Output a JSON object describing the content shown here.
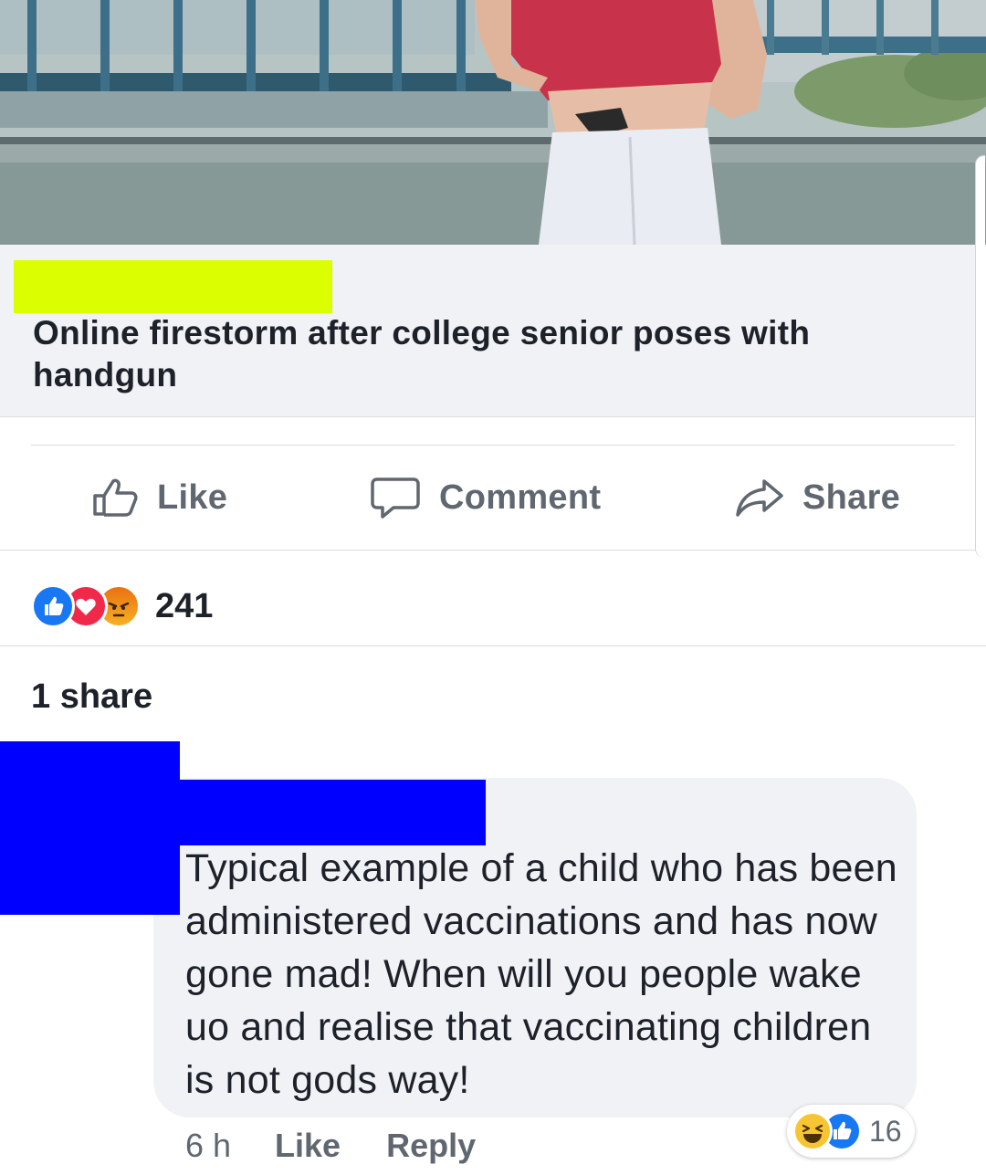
{
  "link_preview": {
    "title": "Online firestorm after college senior poses with handgun"
  },
  "actions": {
    "like_label": "Like",
    "comment_label": "Comment",
    "share_label": "Share"
  },
  "reactions": {
    "types": [
      "like",
      "love",
      "angry"
    ],
    "count": "241"
  },
  "shares": "1 share",
  "comment": {
    "text": "Typical example of a child who has been administered vaccinations and has now gone mad! When will you people wake uo and realise that vaccinating children is not gods way!",
    "time": "6 h",
    "like_label": "Like",
    "reply_label": "Reply",
    "reaction_types": [
      "haha",
      "like"
    ],
    "reaction_count": "16"
  },
  "colors": {
    "redaction_yellow": "#dcff00",
    "redaction_blue": "#0000ff",
    "like_blue": "#1877f2",
    "love_red": "#f0284a",
    "angry_orange": "#e9710f",
    "haha_yellow": "#f7c531",
    "muted_text": "#606770"
  }
}
